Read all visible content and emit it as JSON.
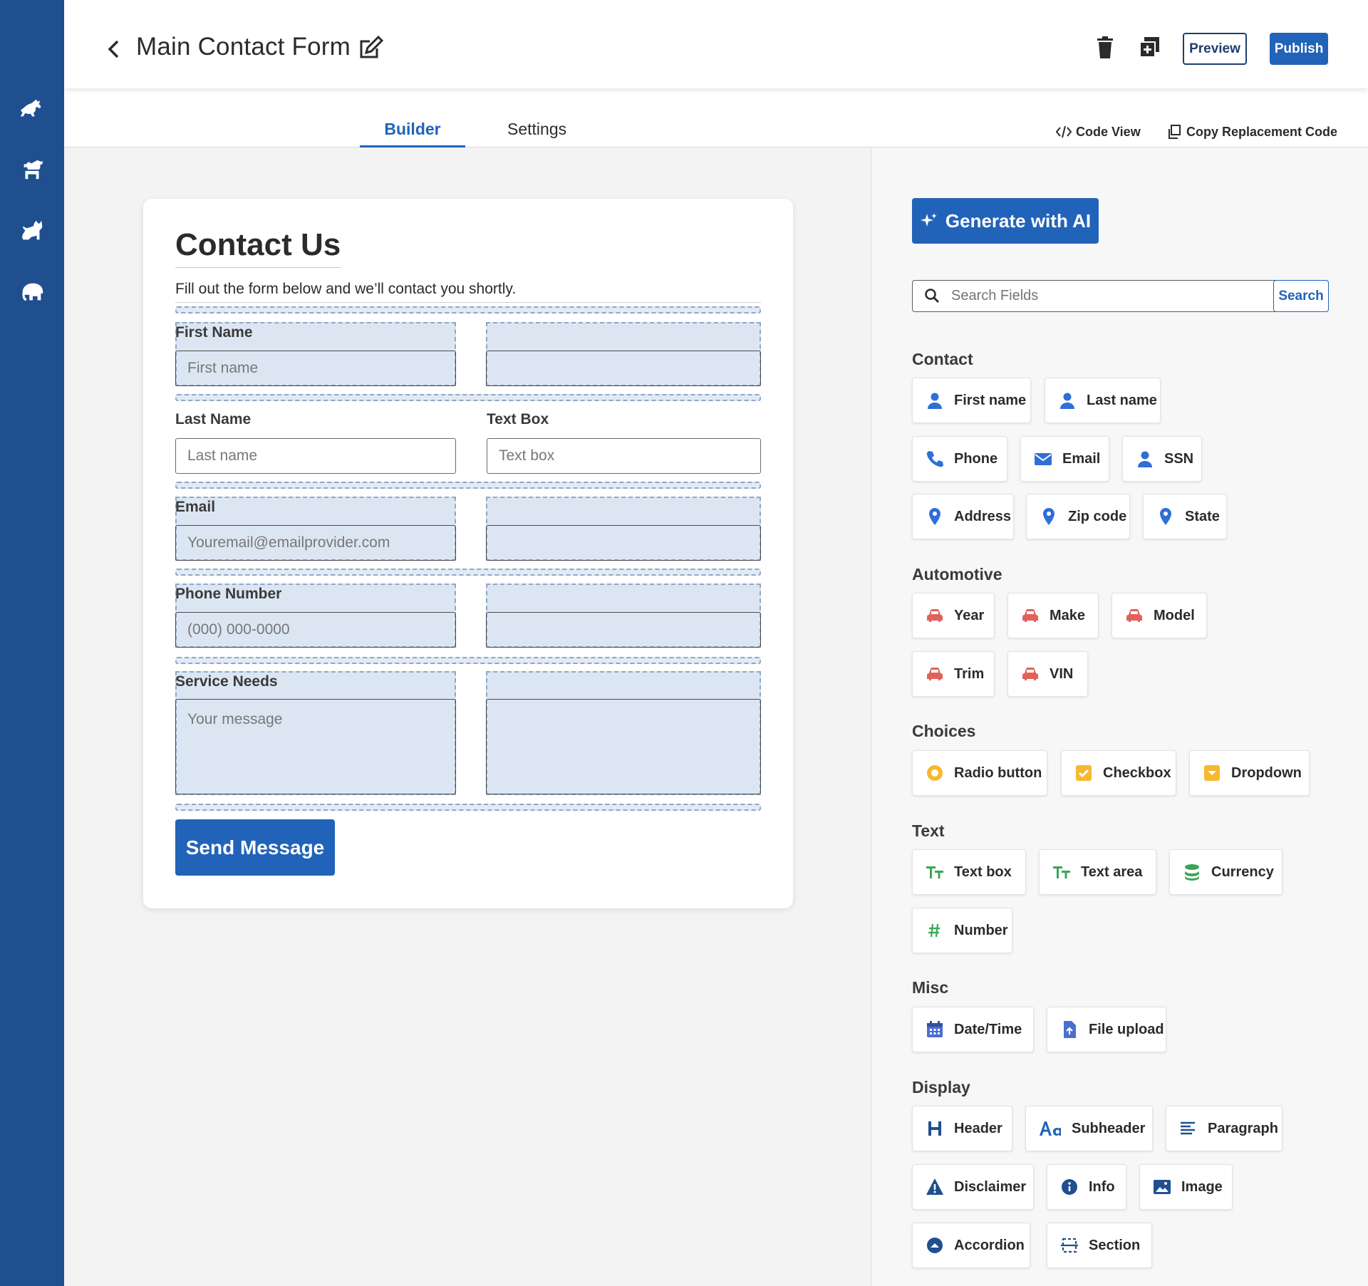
{
  "header": {
    "title": "Main Contact Form",
    "preview_label": "Preview",
    "publish_label": "Publish"
  },
  "tabs": {
    "builder": "Builder",
    "settings": "Settings"
  },
  "tools": {
    "code_view": "Code View",
    "copy_code": "Copy Replacement Code"
  },
  "form": {
    "title": "Contact Us",
    "subtitle": "Fill out the form below and we’ll contact you shortly.",
    "fields": {
      "first_name": {
        "label": "First Name",
        "placeholder": "First name"
      },
      "last_name": {
        "label": "Last Name",
        "placeholder": "Last name"
      },
      "text_box": {
        "label": "Text Box",
        "placeholder": "Text box"
      },
      "email": {
        "label": "Email",
        "placeholder": "Youremail@emailprovider.com"
      },
      "phone": {
        "label": "Phone Number",
        "placeholder": "(000) 000-0000"
      },
      "service": {
        "label": "Service Needs",
        "placeholder": "Your message"
      }
    },
    "submit_label": "Send Message"
  },
  "panel": {
    "generate_label": "Generate with AI",
    "search_placeholder": "Search Fields",
    "search_button": "Search",
    "groups": {
      "contact": {
        "title": "Contact",
        "items": [
          "First name",
          "Last name",
          "Phone",
          "Email",
          "SSN",
          "Address",
          "Zip code",
          "State"
        ]
      },
      "automotive": {
        "title": "Automotive",
        "items": [
          "Year",
          "Make",
          "Model",
          "Trim",
          "VIN"
        ]
      },
      "choices": {
        "title": "Choices",
        "items": [
          "Radio button",
          "Checkbox",
          "Dropdown"
        ]
      },
      "text": {
        "title": "Text",
        "items": [
          "Text box",
          "Text area",
          "Currency",
          "Number"
        ]
      },
      "misc": {
        "title": "Misc",
        "items": [
          "Date/Time",
          "File upload"
        ]
      },
      "display": {
        "title": "Display",
        "items": [
          "Header",
          "Subheader",
          "Paragraph",
          "Disclaimer",
          "Info",
          "Image",
          "Accordion",
          "Section"
        ]
      }
    }
  },
  "colors": {
    "brand": "#2163b8",
    "rail": "#1f4f8f",
    "car_icon": "#e0625a",
    "choice_icon": "#f5b82e",
    "text_icon": "#3aa655"
  }
}
